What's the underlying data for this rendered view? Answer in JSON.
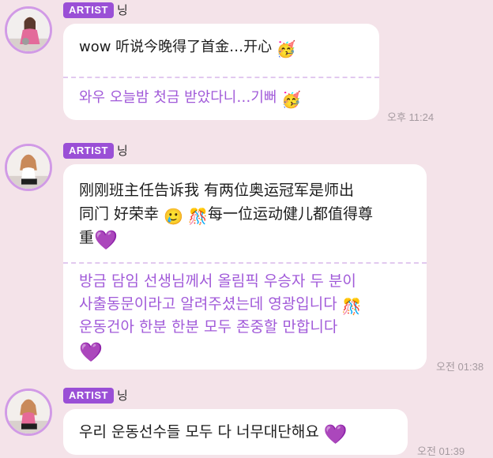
{
  "messages": [
    {
      "badge": "ARTIST",
      "sender": "닝",
      "original": "wow 听说今晚得了首金…开心",
      "original_emoji": "🥳",
      "translation": "와우 오늘밤 첫금 받았다니…기뻐",
      "translation_emoji": "🥳",
      "time": "오후 11:24"
    },
    {
      "badge": "ARTIST",
      "sender": "닝",
      "original_line1": "刚刚班主任告诉我 有两位奥运冠军是师出",
      "original_line2_a": "同门 好荣幸",
      "original_line2_emoji1": "🥲",
      "original_line2_emoji2": "🎊",
      "original_line2_b": "每一位运动健儿都值得尊",
      "original_line3": "重",
      "original_line3_emoji": "💜",
      "translation_line1": "방금 담임 선생님께서 올림픽 우승자 두 분이",
      "translation_line2": "사출동문이라고 알려주셨는데 영광입니다",
      "translation_line2_emoji": "🎊",
      "translation_line3": "운동건아 한분 한분 모두 존중할 만합니다",
      "translation_line4_emoji": "💜",
      "time": "오전 01:38"
    },
    {
      "badge": "ARTIST",
      "sender": "닝",
      "original": "우리 운동선수들 모두 다 너무대단해요",
      "original_emoji": "💜",
      "time": "오전 01:39"
    }
  ],
  "colors": {
    "background": "#f4e3e9",
    "badge": "#9a4fd6",
    "translation_text": "#a15ad9",
    "avatar_ring": "#d19ae6"
  }
}
